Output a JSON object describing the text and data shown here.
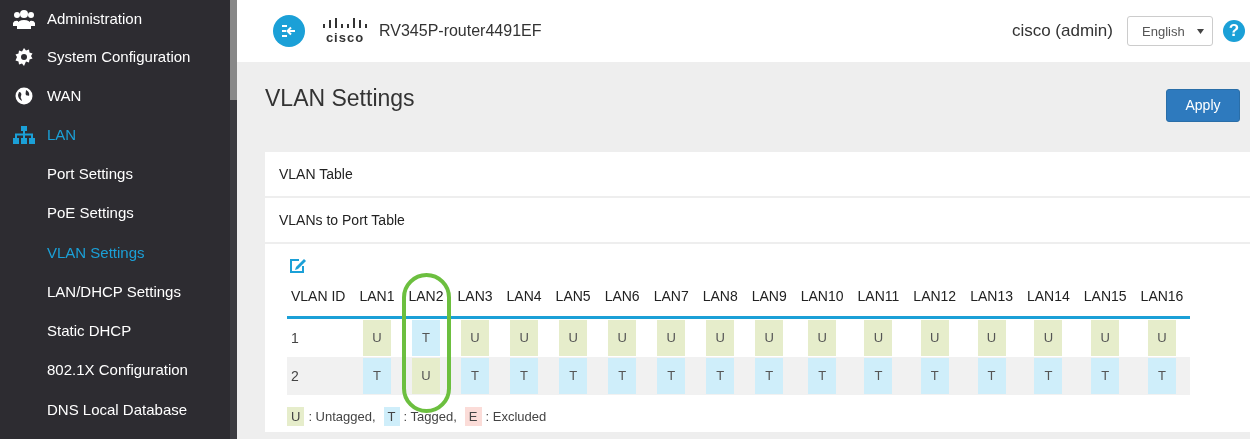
{
  "sidebar": {
    "items": [
      {
        "label": "Administration",
        "active": false
      },
      {
        "label": "System Configuration",
        "active": false
      },
      {
        "label": "WAN",
        "active": false
      },
      {
        "label": "LAN",
        "active": true,
        "children": [
          {
            "label": "Port Settings",
            "selected": false
          },
          {
            "label": "PoE Settings",
            "selected": false
          },
          {
            "label": "VLAN Settings",
            "selected": true
          },
          {
            "label": "LAN/DHCP Settings",
            "selected": false
          },
          {
            "label": "Static DHCP",
            "selected": false
          },
          {
            "label": "802.1X Configuration",
            "selected": false
          },
          {
            "label": "DNS Local Database",
            "selected": false
          }
        ]
      }
    ]
  },
  "header": {
    "logo": "cisco",
    "device": "RV345P-router4491EF",
    "user": "cisco (admin)",
    "language": "English",
    "help": "?"
  },
  "page": {
    "title": "VLAN Settings",
    "apply": "Apply"
  },
  "sections": [
    "VLAN Table",
    "VLANs to Port Table"
  ],
  "table": {
    "columns": [
      {
        "label": "VLAN ID",
        "highlighted": false
      },
      {
        "label": "LAN1",
        "highlighted": false
      },
      {
        "label": "LAN2",
        "highlighted": true
      },
      {
        "label": "LAN3",
        "highlighted": false
      },
      {
        "label": "LAN4",
        "highlighted": false
      },
      {
        "label": "LAN5",
        "highlighted": false
      },
      {
        "label": "LAN6",
        "highlighted": false
      },
      {
        "label": "LAN7",
        "highlighted": false
      },
      {
        "label": "LAN8",
        "highlighted": false
      },
      {
        "label": "LAN9",
        "highlighted": false
      },
      {
        "label": "LAN10",
        "highlighted": false
      },
      {
        "label": "LAN11",
        "highlighted": false
      },
      {
        "label": "LAN12",
        "highlighted": false
      },
      {
        "label": "LAN13",
        "highlighted": false
      },
      {
        "label": "LAN14",
        "highlighted": false
      },
      {
        "label": "LAN15",
        "highlighted": false
      },
      {
        "label": "LAN16",
        "highlighted": false
      }
    ],
    "rows": [
      {
        "cells": [
          {
            "kind": "id",
            "text": "1"
          },
          {
            "kind": "untagged",
            "text": "U"
          },
          {
            "kind": "tagged",
            "text": "T"
          },
          {
            "kind": "untagged",
            "text": "U"
          },
          {
            "kind": "untagged",
            "text": "U"
          },
          {
            "kind": "untagged",
            "text": "U"
          },
          {
            "kind": "untagged",
            "text": "U"
          },
          {
            "kind": "untagged",
            "text": "U"
          },
          {
            "kind": "untagged",
            "text": "U"
          },
          {
            "kind": "untagged",
            "text": "U"
          },
          {
            "kind": "untagged",
            "text": "U"
          },
          {
            "kind": "untagged",
            "text": "U"
          },
          {
            "kind": "untagged",
            "text": "U"
          },
          {
            "kind": "untagged",
            "text": "U"
          },
          {
            "kind": "untagged",
            "text": "U"
          },
          {
            "kind": "untagged",
            "text": "U"
          },
          {
            "kind": "untagged",
            "text": "U"
          }
        ]
      },
      {
        "cells": [
          {
            "kind": "id",
            "text": "2"
          },
          {
            "kind": "tagged",
            "text": "T"
          },
          {
            "kind": "untagged",
            "text": "U"
          },
          {
            "kind": "tagged",
            "text": "T"
          },
          {
            "kind": "tagged",
            "text": "T"
          },
          {
            "kind": "tagged",
            "text": "T"
          },
          {
            "kind": "tagged",
            "text": "T"
          },
          {
            "kind": "tagged",
            "text": "T"
          },
          {
            "kind": "tagged",
            "text": "T"
          },
          {
            "kind": "tagged",
            "text": "T"
          },
          {
            "kind": "tagged",
            "text": "T"
          },
          {
            "kind": "tagged",
            "text": "T"
          },
          {
            "kind": "tagged",
            "text": "T"
          },
          {
            "kind": "tagged",
            "text": "T"
          },
          {
            "kind": "tagged",
            "text": "T"
          },
          {
            "kind": "tagged",
            "text": "T"
          },
          {
            "kind": "tagged",
            "text": "T"
          }
        ]
      }
    ]
  },
  "legend": [
    {
      "kind": "untagged",
      "code": "U",
      "label": ": Untagged,"
    },
    {
      "kind": "tagged",
      "code": "T",
      "label": ": Tagged,"
    },
    {
      "kind": "excluded",
      "code": "E",
      "label": ": Excluded"
    }
  ]
}
